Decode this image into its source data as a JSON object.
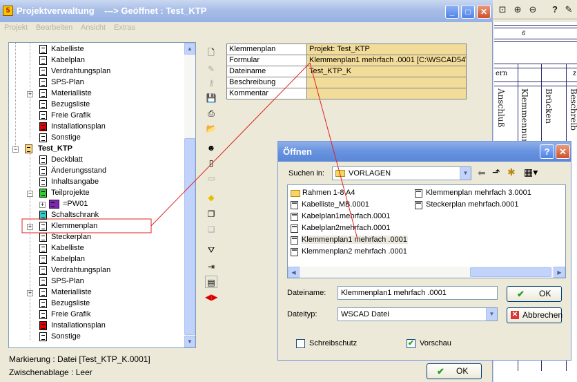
{
  "window": {
    "title": "Projektverwaltung    ---> Geöffnet : Test_KTP",
    "app_icon_letter": "5"
  },
  "menu": [
    "Projekt",
    "Bearbeiten",
    "Ansicht",
    "Extras"
  ],
  "tree": {
    "rows_top": [
      "Kabelliste",
      "Kabelplan",
      "Verdrahtungsplan",
      "SPS-Plan",
      "Materialliste",
      "Bezugsliste",
      "Freie Grafik",
      "Installationsplan",
      "Sonstige"
    ],
    "project": "Test_KTP",
    "rows_project": [
      "Deckblatt",
      "Änderungsstand",
      "Inhaltsangabe",
      "Teilprojekte",
      "=PW01",
      "Schaltschrank",
      "Klemmenplan",
      "Steckerplan",
      "Kabelliste",
      "Kabelplan",
      "Verdrahtungsplan",
      "SPS-Plan",
      "Materialliste",
      "Bezugsliste",
      "Freie Grafik",
      "Installationsplan",
      "Sonstige"
    ]
  },
  "properties": [
    {
      "key": "Klemmenplan",
      "value": "Projekt: Test_KTP"
    },
    {
      "key": "Formular",
      "value": "Klemmenplan1 mehrfach .0001 [C:\\WSCAD54\\"
    },
    {
      "key": "Dateiname",
      "value": "Test_KTP_K"
    },
    {
      "key": "Beschreibung",
      "value": ""
    },
    {
      "key": "Kommentar",
      "value": ""
    }
  ],
  "status": {
    "markierung": "Markierung : Datei [Test_KTP_K.0001]",
    "zwischenablage": "Zwischenablage : Leer"
  },
  "main_ok": "OK",
  "dialog": {
    "title": "Öffnen",
    "suchen_in_label": "Suchen in:",
    "folder": "VORLAGEN",
    "files_col1": [
      "Rahmen 1-8 A4",
      "Kabelliste_MB.0001",
      "Kabelplan1mehrfach.0001",
      "Kabelplan2mehrfach.0001",
      "Klemmenplan1 mehrfach .0001",
      "Klemmenplan2 mehrfach .0001"
    ],
    "files_col2": [
      "Klemmenplan mehrfach 3.0001",
      "Steckerplan mehrfach.0001"
    ],
    "dateiname_label": "Dateiname:",
    "dateiname_value": "Klemmenplan1 mehrfach .0001",
    "dateityp_label": "Dateityp:",
    "dateityp_value": "WSCAD Datei",
    "ok": "OK",
    "abbrechen": "Abbrechen",
    "schreibschutz": "Schreibschutz",
    "vorschau": "Vorschau"
  },
  "background_sheet": {
    "col_number": "6",
    "header": "ern",
    "vertical_labels": [
      "Anschluß",
      "Klemmennumm",
      "Brücken",
      "Beschreib"
    ]
  },
  "icons": {
    "minimize": "minimize-icon",
    "maximize": "maximize-icon",
    "close": "close-icon",
    "help": "help-icon"
  },
  "colors": {
    "property_value_bg": "#f2dc9a",
    "annotation_red": "#e02020",
    "ok_check": "#21a121"
  }
}
